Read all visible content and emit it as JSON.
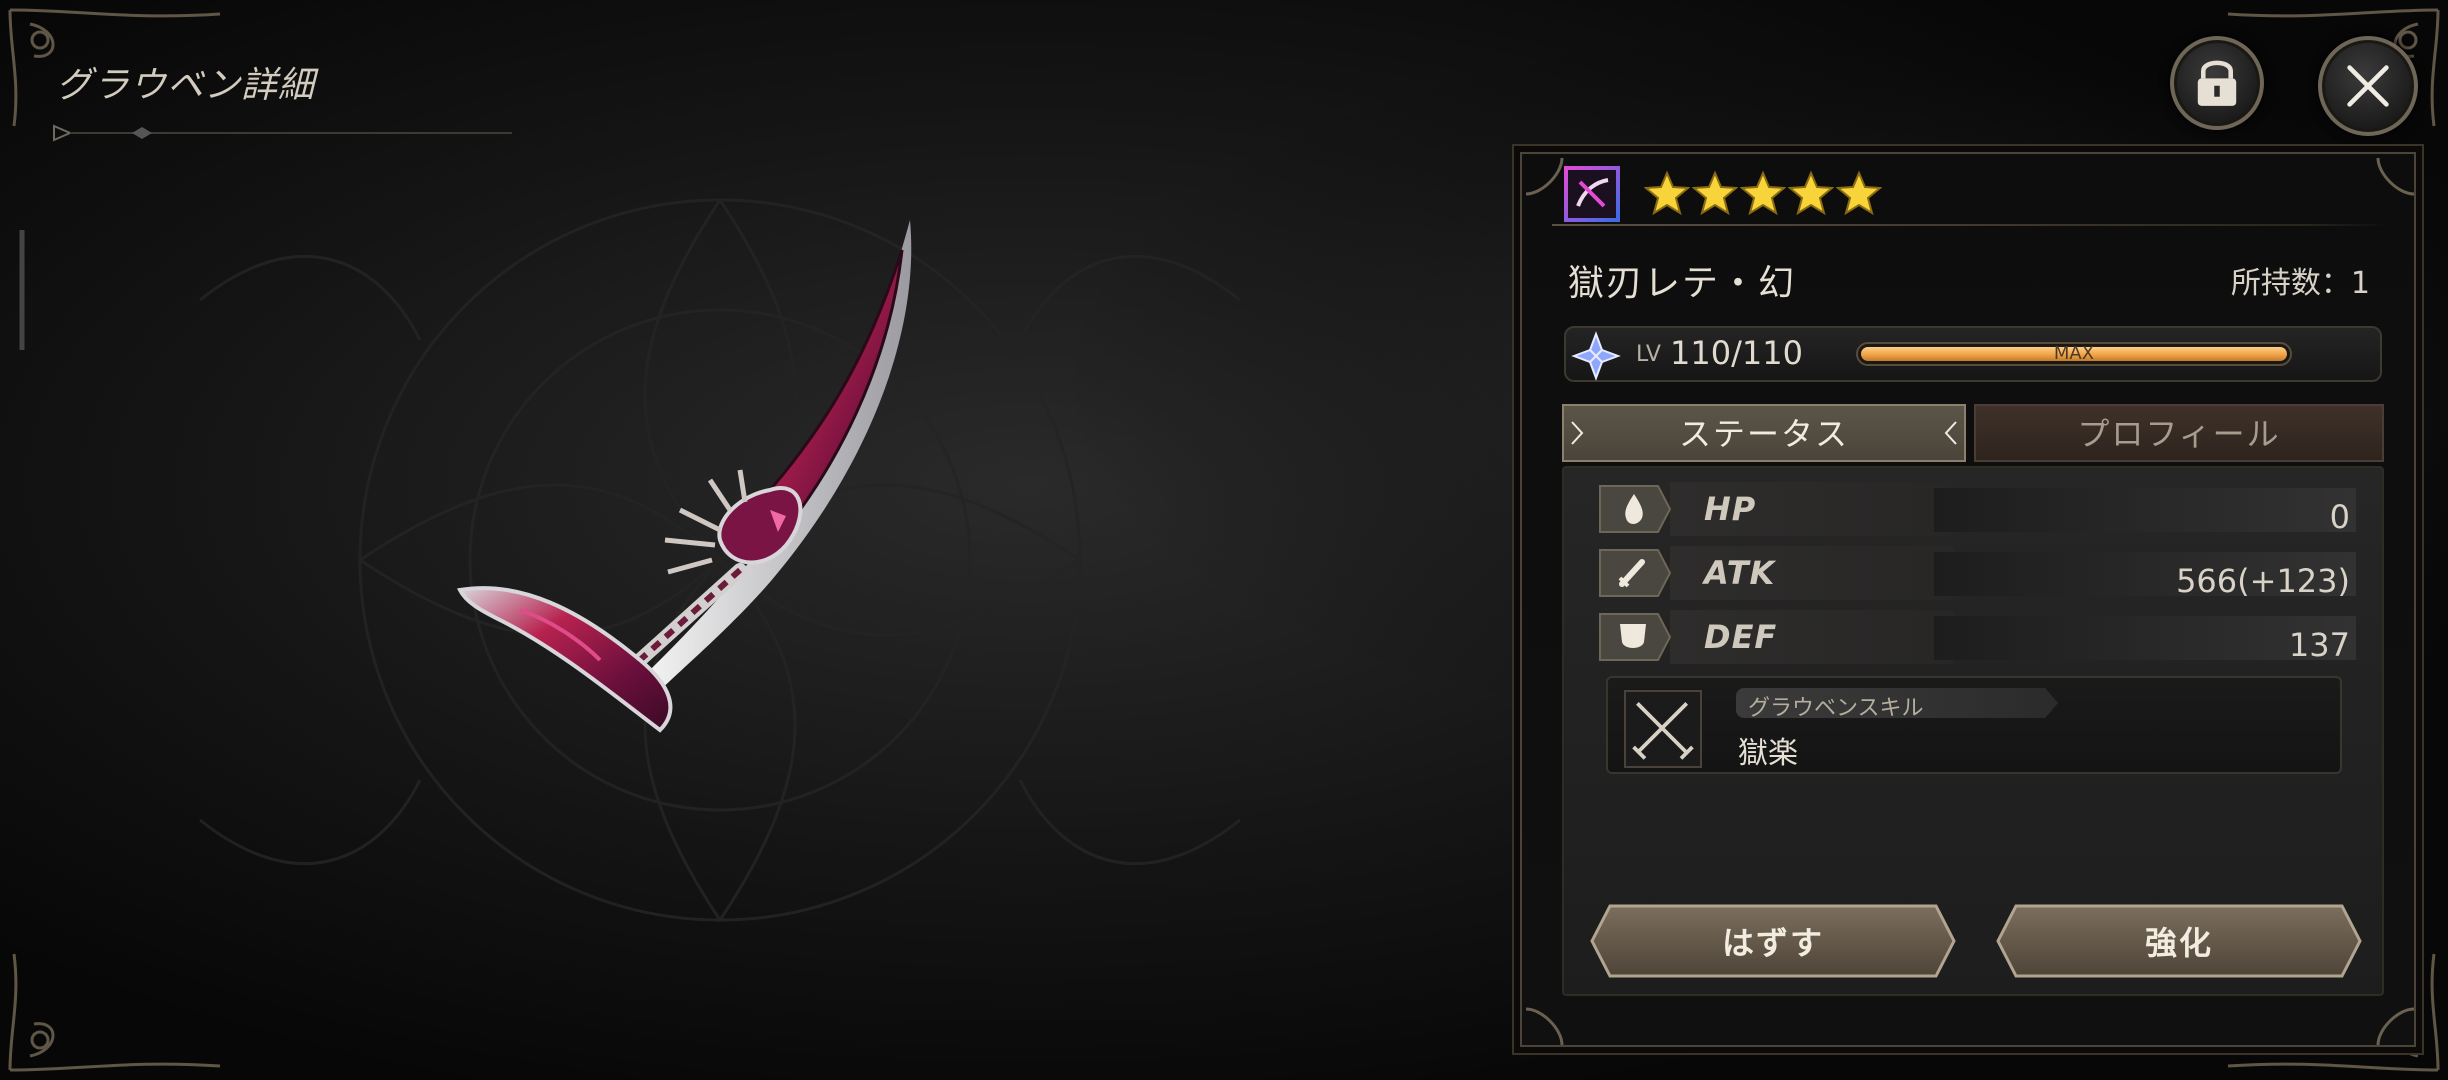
{
  "header": {
    "title": "グラウベン詳細"
  },
  "top_controls": {
    "lock_icon": "lock-icon",
    "close_icon": "close-icon"
  },
  "weapon": {
    "element_icon": "crossed-blade-element-icon",
    "rarity_stars": 5,
    "name": "獄刃レテ・幻",
    "owned_label": "所持数：1",
    "level": {
      "prefix": "LV",
      "value": "110/110",
      "bar_label": "MAX",
      "progress": 1.0
    }
  },
  "tabs": [
    {
      "label": "ステータス",
      "active": true
    },
    {
      "label": "プロフィール",
      "active": false
    }
  ],
  "stats": [
    {
      "label": "HP",
      "value": "0",
      "icon": "drop-icon"
    },
    {
      "label": "ATK",
      "value": "566(+123)",
      "icon": "sword-icon"
    },
    {
      "label": "DEF",
      "value": "137",
      "icon": "shield-icon"
    }
  ],
  "skill": {
    "tag": "グラウベンスキル",
    "name": "獄楽",
    "icon": "crossed-swords-icon"
  },
  "actions": {
    "unequip_label": "はずす",
    "enhance_label": "強化"
  },
  "colors": {
    "star": "#f6d43a",
    "exp_fill": "#f0a347",
    "blade_accent": "#8a1e5a",
    "frame_gold": "#8a806c"
  }
}
